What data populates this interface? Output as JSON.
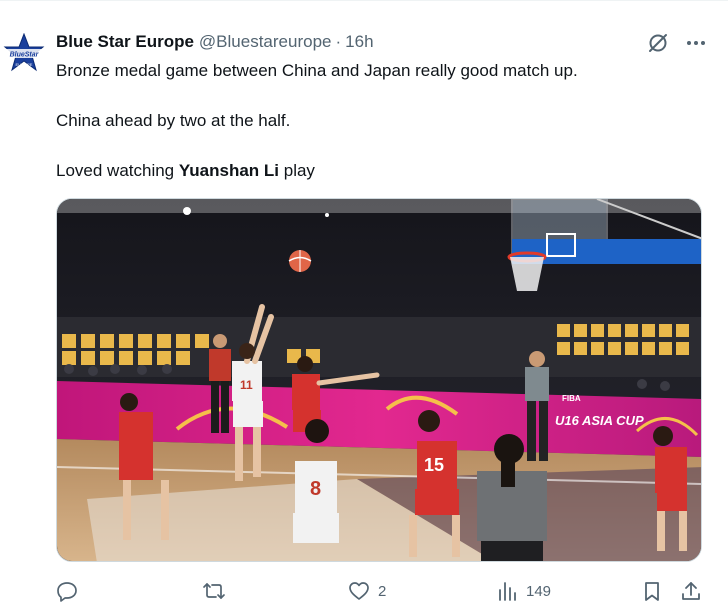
{
  "author": {
    "display_name": "Blue Star Europe",
    "handle": "@Bluestareurope",
    "separator": "·",
    "time": "16h",
    "avatar_icon": "blue-star-logo-icon"
  },
  "post": {
    "line1_text": "Bronze medal game between China and Japan really good match up.",
    "line2_text": "China ahead by two at the half.",
    "line3_prefix": "Loved watching ",
    "line3_bold": "Yuanshan Li",
    "line3_suffix": " play"
  },
  "media": {
    "type": "photo",
    "description_icon": "basketball-game-photo",
    "jersey_numbers": [
      "11",
      "8",
      "15"
    ],
    "banner_text": "U16 ASIA CUP",
    "fiba_text": "FIBA"
  },
  "actions": {
    "reply_count": "",
    "repost_count": "",
    "like_count": "2",
    "views_count": "149"
  },
  "top_icons": [
    "grok-icon",
    "more-icon"
  ],
  "colors": {
    "text_primary": "#0f1419",
    "text_secondary": "#536471",
    "accent": "#1d9bf0",
    "banner_pink": "#d8208a"
  }
}
